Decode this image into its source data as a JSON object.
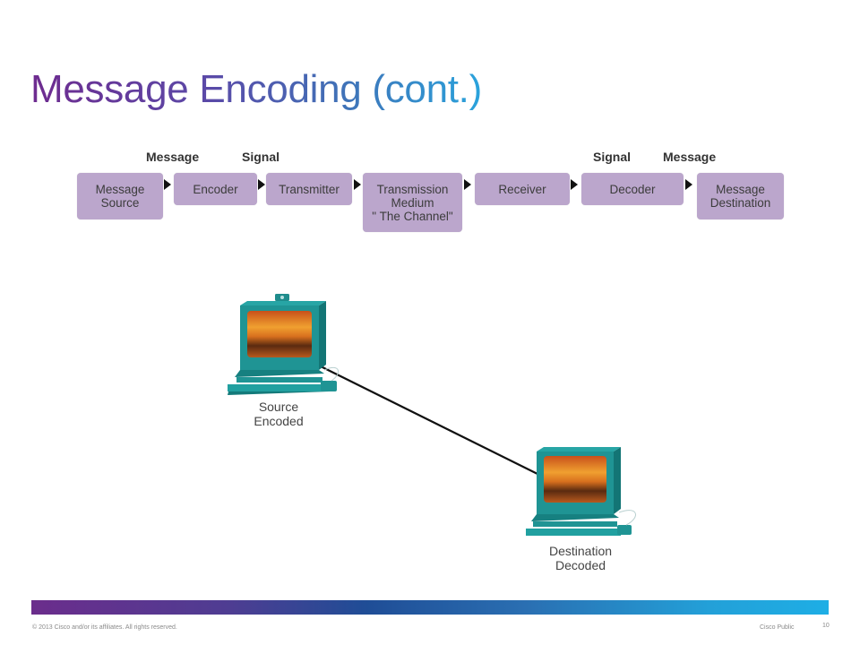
{
  "slide": {
    "title": "Message Encoding (cont.)",
    "flow": {
      "labels": [
        "Message",
        "Signal",
        "Signal",
        "Message"
      ],
      "boxes": [
        {
          "text": "Message\nSource"
        },
        {
          "text": "Encoder"
        },
        {
          "text": "Transmitter"
        },
        {
          "text": "Transmission\nMedium\n\" The Channel\""
        },
        {
          "text": "Receiver"
        },
        {
          "text": "Decoder"
        },
        {
          "text": "Message\nDestination"
        }
      ],
      "box_color": "#bba6cc"
    },
    "network": {
      "source_label": "Source\nEncoded",
      "destination_label": "Destination\nDecoded",
      "computer_color": "#1f9696"
    },
    "footer": {
      "copyright": "© 2013 Cisco and/or its affiliates. All rights reserved.",
      "classification": "Cisco Public",
      "page_number": "10"
    }
  }
}
